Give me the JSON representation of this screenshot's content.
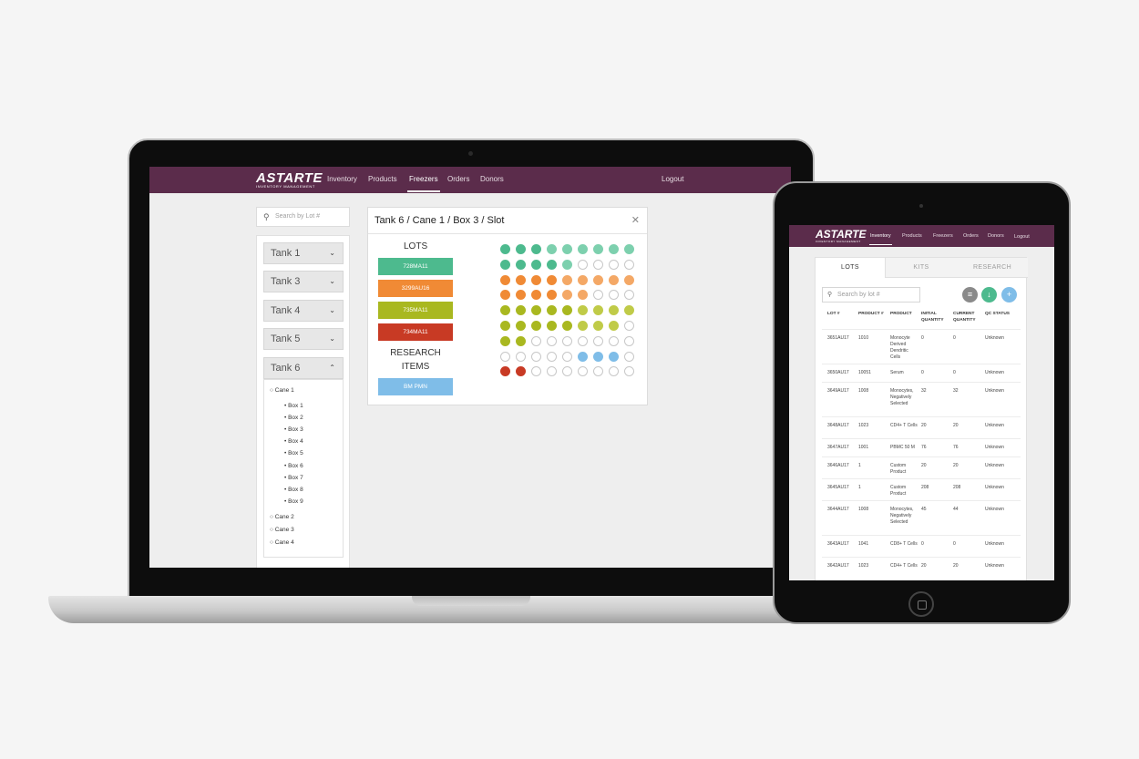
{
  "laptop": {
    "logo": "ASTARTE",
    "logo_sub": "INVENTORY MANAGEMENT",
    "nav": [
      "Inventory",
      "Products",
      "Freezers",
      "Orders",
      "Donors"
    ],
    "logout": "Logout",
    "search_placeholder": "Search by Lot #",
    "tanks": [
      "Tank 1",
      "Tank 3",
      "Tank 4",
      "Tank 5",
      "Tank 6"
    ],
    "tree": {
      "cane1": "Cane 1",
      "boxes": [
        "Box 1",
        "Box 2",
        "Box 3",
        "Box 4",
        "Box 5",
        "Box 6",
        "Box 7",
        "Box 8",
        "Box 9"
      ],
      "canes": [
        "Cane 2",
        "Cane 3",
        "Cane 4"
      ]
    },
    "slot_title": "Tank 6 / Cane 1 / Box 3 / Slot",
    "lots_heading": "LOTS",
    "lots": [
      "728MA11",
      "3299AU16",
      "735MA11",
      "734MA11"
    ],
    "research_heading": "RESEARCH ITEMS",
    "research": [
      "BM PMN"
    ],
    "colors": {
      "nav": "#5b2c4b",
      "teal": "#4dba8e",
      "teal_light": "#7dd0ae",
      "orange": "#f08a35",
      "orange_light": "#f4a866",
      "olive": "#a9b820",
      "olive_light": "#c0cb48",
      "red": "#c83a24",
      "blue": "#7fbde8"
    },
    "grid_rows": [
      [
        "teal",
        "teal",
        "teal",
        "teal_light",
        "teal_light",
        "teal_light",
        "teal_light",
        "teal_light",
        "teal_light"
      ],
      [
        "teal",
        "teal",
        "teal",
        "teal",
        "teal_light",
        "empty",
        "empty",
        "empty",
        "empty"
      ],
      [
        "orange",
        "orange",
        "orange",
        "orange",
        "orange_light",
        "orange_light",
        "orange_light",
        "orange_light",
        "orange_light"
      ],
      [
        "orange",
        "orange",
        "orange",
        "orange",
        "orange_light",
        "orange_light",
        "empty",
        "empty",
        "empty"
      ],
      [
        "olive",
        "olive",
        "olive",
        "olive",
        "olive",
        "olive_light",
        "olive_light",
        "olive_light",
        "olive_light"
      ],
      [
        "olive",
        "olive",
        "olive",
        "olive",
        "olive",
        "olive_light",
        "olive_light",
        "olive_light",
        "empty"
      ],
      [
        "olive",
        "olive",
        "empty",
        "empty",
        "empty",
        "empty",
        "empty",
        "empty",
        "empty"
      ],
      [
        "empty",
        "empty",
        "empty",
        "empty",
        "empty",
        "blue",
        "blue",
        "blue",
        "empty"
      ],
      [
        "red",
        "red",
        "empty",
        "empty",
        "empty",
        "empty",
        "empty",
        "empty",
        "empty"
      ]
    ]
  },
  "tablet": {
    "logo": "ASTARTE",
    "logo_sub": "INVENTORY MANAGEMENT",
    "nav": [
      "Inventory",
      "Products",
      "Freezers",
      "Orders",
      "Donors"
    ],
    "logout": "Logout",
    "tabs": [
      "LOTS",
      "KITS",
      "RESEARCH"
    ],
    "search_placeholder": "Search by lot #",
    "action_icons": [
      "filter-icon",
      "download-icon",
      "add-icon"
    ],
    "headers": [
      "LOT #",
      "PRODUCT #",
      "PRODUCT",
      "INITIAL QUANTITY",
      "CURRENT QUANTITY",
      "QC STATUS"
    ],
    "rows": [
      [
        "3651AU17",
        "1010",
        "Monocyte Derived Dendritic Cells",
        "0",
        "0",
        "Unknown"
      ],
      [
        "3650AU17",
        "10051",
        "Serum",
        "0",
        "0",
        "Unknown"
      ],
      [
        "3649AU17",
        "1008",
        "Monocytes, Negatively Selected",
        "32",
        "32",
        "Unknown"
      ],
      [
        "3648AU17",
        "1023",
        "CD4+ T Cells",
        "20",
        "20",
        "Unknown"
      ],
      [
        "3647AU17",
        "1001",
        "PBMC 50 M",
        "76",
        "76",
        "Unknown"
      ],
      [
        "3646AU17",
        "1",
        "Custom Product",
        "20",
        "20",
        "Unknown"
      ],
      [
        "3645AU17",
        "1",
        "Custom Product",
        "208",
        "208",
        "Unknown"
      ],
      [
        "3644AU17",
        "1008",
        "Monocytes, Negatively Selected",
        "45",
        "44",
        "Unknown"
      ],
      [
        "3643AU17",
        "1041",
        "CD8+ T Cells",
        "0",
        "0",
        "Unknown"
      ],
      [
        "3642AU17",
        "1023",
        "CD4+ T Cells",
        "20",
        "20",
        "Unknown"
      ]
    ]
  }
}
